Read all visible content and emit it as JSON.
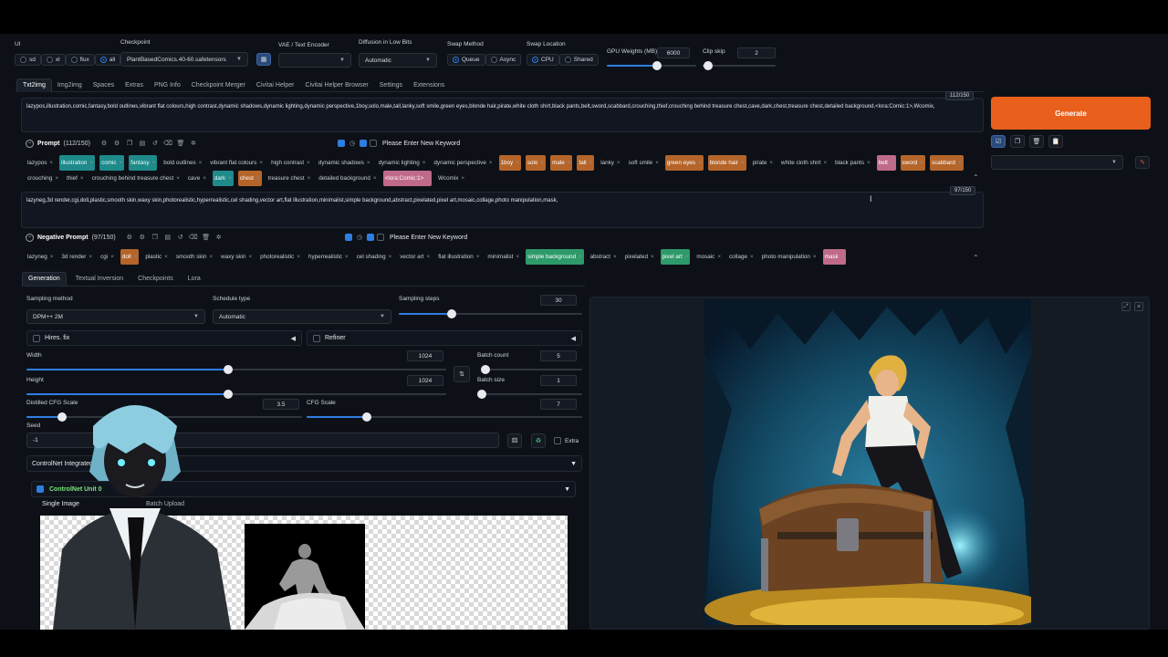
{
  "top": {
    "ui_label": "UI",
    "ui_options": [
      "sd",
      "xl",
      "flux",
      "all"
    ],
    "checkpoint_label": "Checkpoint",
    "checkpoint_value": "PlantBasedComics.40-60.safetensors",
    "vae_label": "VAE / Text Encoder",
    "vae_value": "",
    "diffusion_label": "Diffusion in Low Bits",
    "diffusion_value": "Automatic",
    "swap_method_label": "Swap Method",
    "swap_method_options": [
      "Queue",
      "Async"
    ],
    "swap_location_label": "Swap Location",
    "swap_location_options": [
      "CPU",
      "Shared"
    ],
    "gpu_weights_label": "GPU Weights (MB)",
    "gpu_weights_value": "6000",
    "gpu_weights_level": 0.56,
    "clip_skip_label": "Clip skip",
    "clip_skip_value": "2",
    "clip_skip_level": 0.08
  },
  "tabs": [
    "Txt2img",
    "Img2img",
    "Spaces",
    "Extras",
    "PNG Info",
    "Checkpoint Merger",
    "Civitai Helper",
    "Civitai Helper Browser",
    "Settings",
    "Extensions"
  ],
  "prompt": {
    "counter": "112/150",
    "text": "lazypos,illustration,comic,fantasy,bold outlines,vibrant flat colours,high contrast,dynamic shadows,dynamic lighting,dynamic perspective,1boy,solo,male,tall,lanky,soft smile,green eyes,blonde hair,pirate,white cloth shirt,black pants,belt,sword,scabbard,crouching,thief,crouching behind treasure chest,cave,dark,chest,treasure chest,detailed background,<lora:Comic:1>,Wcomix,",
    "label": "Prompt",
    "label_count": "(112/150)",
    "keyword_placeholder": "Please Enter New Keyword",
    "chips": [
      {
        "t": "lazypos",
        "c": ""
      },
      {
        "t": "illustration",
        "c": "teal"
      },
      {
        "t": "comic",
        "c": "teal"
      },
      {
        "t": "fantasy",
        "c": "teal"
      },
      {
        "t": "bold outlines",
        "c": ""
      },
      {
        "t": "vibrant flat colours",
        "c": ""
      },
      {
        "t": "high contrast",
        "c": ""
      },
      {
        "t": "dynamic shadows",
        "c": ""
      },
      {
        "t": "dynamic lighting",
        "c": ""
      },
      {
        "t": "dynamic perspective",
        "c": ""
      },
      {
        "t": "1boy",
        "c": "orange"
      },
      {
        "t": "solo",
        "c": "orange"
      },
      {
        "t": "male",
        "c": "orange"
      },
      {
        "t": "tall",
        "c": "orange"
      },
      {
        "t": "lanky",
        "c": ""
      },
      {
        "t": "soft smile",
        "c": ""
      },
      {
        "t": "green eyes",
        "c": "orange"
      },
      {
        "t": "blonde hair",
        "c": "orange"
      },
      {
        "t": "pirate",
        "c": ""
      },
      {
        "t": "white cloth shirt",
        "c": ""
      },
      {
        "t": "black pants",
        "c": ""
      },
      {
        "t": "belt",
        "c": "pink"
      },
      {
        "t": "sword",
        "c": "orange"
      },
      {
        "t": "scabbard",
        "c": "orange"
      },
      {
        "t": "crouching",
        "c": ""
      },
      {
        "t": "thief",
        "c": ""
      },
      {
        "t": "crouching behind treasure chest",
        "c": ""
      },
      {
        "t": "cave",
        "c": ""
      },
      {
        "t": "dark",
        "c": "teal"
      },
      {
        "t": "chest",
        "c": "orange"
      },
      {
        "t": "treasure chest",
        "c": ""
      },
      {
        "t": "detailed background",
        "c": ""
      },
      {
        "t": "<lora:Comic:1>",
        "c": "pink"
      },
      {
        "t": "Wcomix",
        "c": ""
      }
    ]
  },
  "negative": {
    "counter": "97/150",
    "text": "lazyneg,3d render,cgi,doll,plastic,smooth skin,waxy skin,photorealistic,hyperrealistic,cel shading,vector art,flat illustration,minimalist,simple background,abstract,pixelated,pixel art,mosaic,collage,photo manipulation,mask,",
    "label": "Negative Prompt",
    "label_count": "(97/150)",
    "keyword_placeholder": "Please Enter New Keyword",
    "chips": [
      {
        "t": "lazyneg",
        "c": ""
      },
      {
        "t": "3d render",
        "c": ""
      },
      {
        "t": "cgi",
        "c": ""
      },
      {
        "t": "doll",
        "c": "orange"
      },
      {
        "t": "plastic",
        "c": ""
      },
      {
        "t": "smooth skin",
        "c": ""
      },
      {
        "t": "waxy skin",
        "c": ""
      },
      {
        "t": "photorealistic",
        "c": ""
      },
      {
        "t": "hyperrealistic",
        "c": ""
      },
      {
        "t": "cel shading",
        "c": ""
      },
      {
        "t": "vector art",
        "c": ""
      },
      {
        "t": "flat illustration",
        "c": ""
      },
      {
        "t": "minimalist",
        "c": ""
      },
      {
        "t": "simple background",
        "c": "green"
      },
      {
        "t": "abstract",
        "c": ""
      },
      {
        "t": "pixelated",
        "c": ""
      },
      {
        "t": "pixel art",
        "c": "green"
      },
      {
        "t": "mosaic",
        "c": ""
      },
      {
        "t": "collage",
        "c": ""
      },
      {
        "t": "photo manipulation",
        "c": ""
      },
      {
        "t": "mask",
        "c": "pink"
      }
    ]
  },
  "generate_label": "Generate",
  "subtabs": [
    "Generation",
    "Textual Inversion",
    "Checkpoints",
    "Lora"
  ],
  "gen": {
    "sampling_method_label": "Sampling method",
    "sampling_method_value": "DPM++ 2M",
    "schedule_type_label": "Schedule type",
    "schedule_type_value": "Automatic",
    "sampling_steps_label": "Sampling steps",
    "sampling_steps_value": "30",
    "sampling_steps_level": 0.29,
    "hires_label": "Hires. fix",
    "refiner_label": "Refiner",
    "width_label": "Width",
    "width_value": "1024",
    "width_level": 0.48,
    "height_label": "Height",
    "height_value": "1024",
    "height_level": 0.48,
    "batch_count_label": "Batch count",
    "batch_count_value": "5",
    "batch_count_level": 0.04,
    "batch_size_label": "Batch size",
    "batch_size_value": "1",
    "batch_size_level": 0.0,
    "distilled_cfg_label": "Distilled CFG Scale",
    "distilled_cfg_value": "3.5",
    "distilled_cfg_level": 0.13,
    "cfg_label": "CFG Scale",
    "cfg_value": "7",
    "cfg_level": 0.22,
    "seed_label": "Seed",
    "seed_value": "-1",
    "extra_label": "Extra",
    "controlnet_label": "ControlNet Integrated",
    "controlnet_unit_label": "ControlNet Unit 0",
    "single_image_label": "Single Image",
    "upload_label": "Batch Upload"
  }
}
